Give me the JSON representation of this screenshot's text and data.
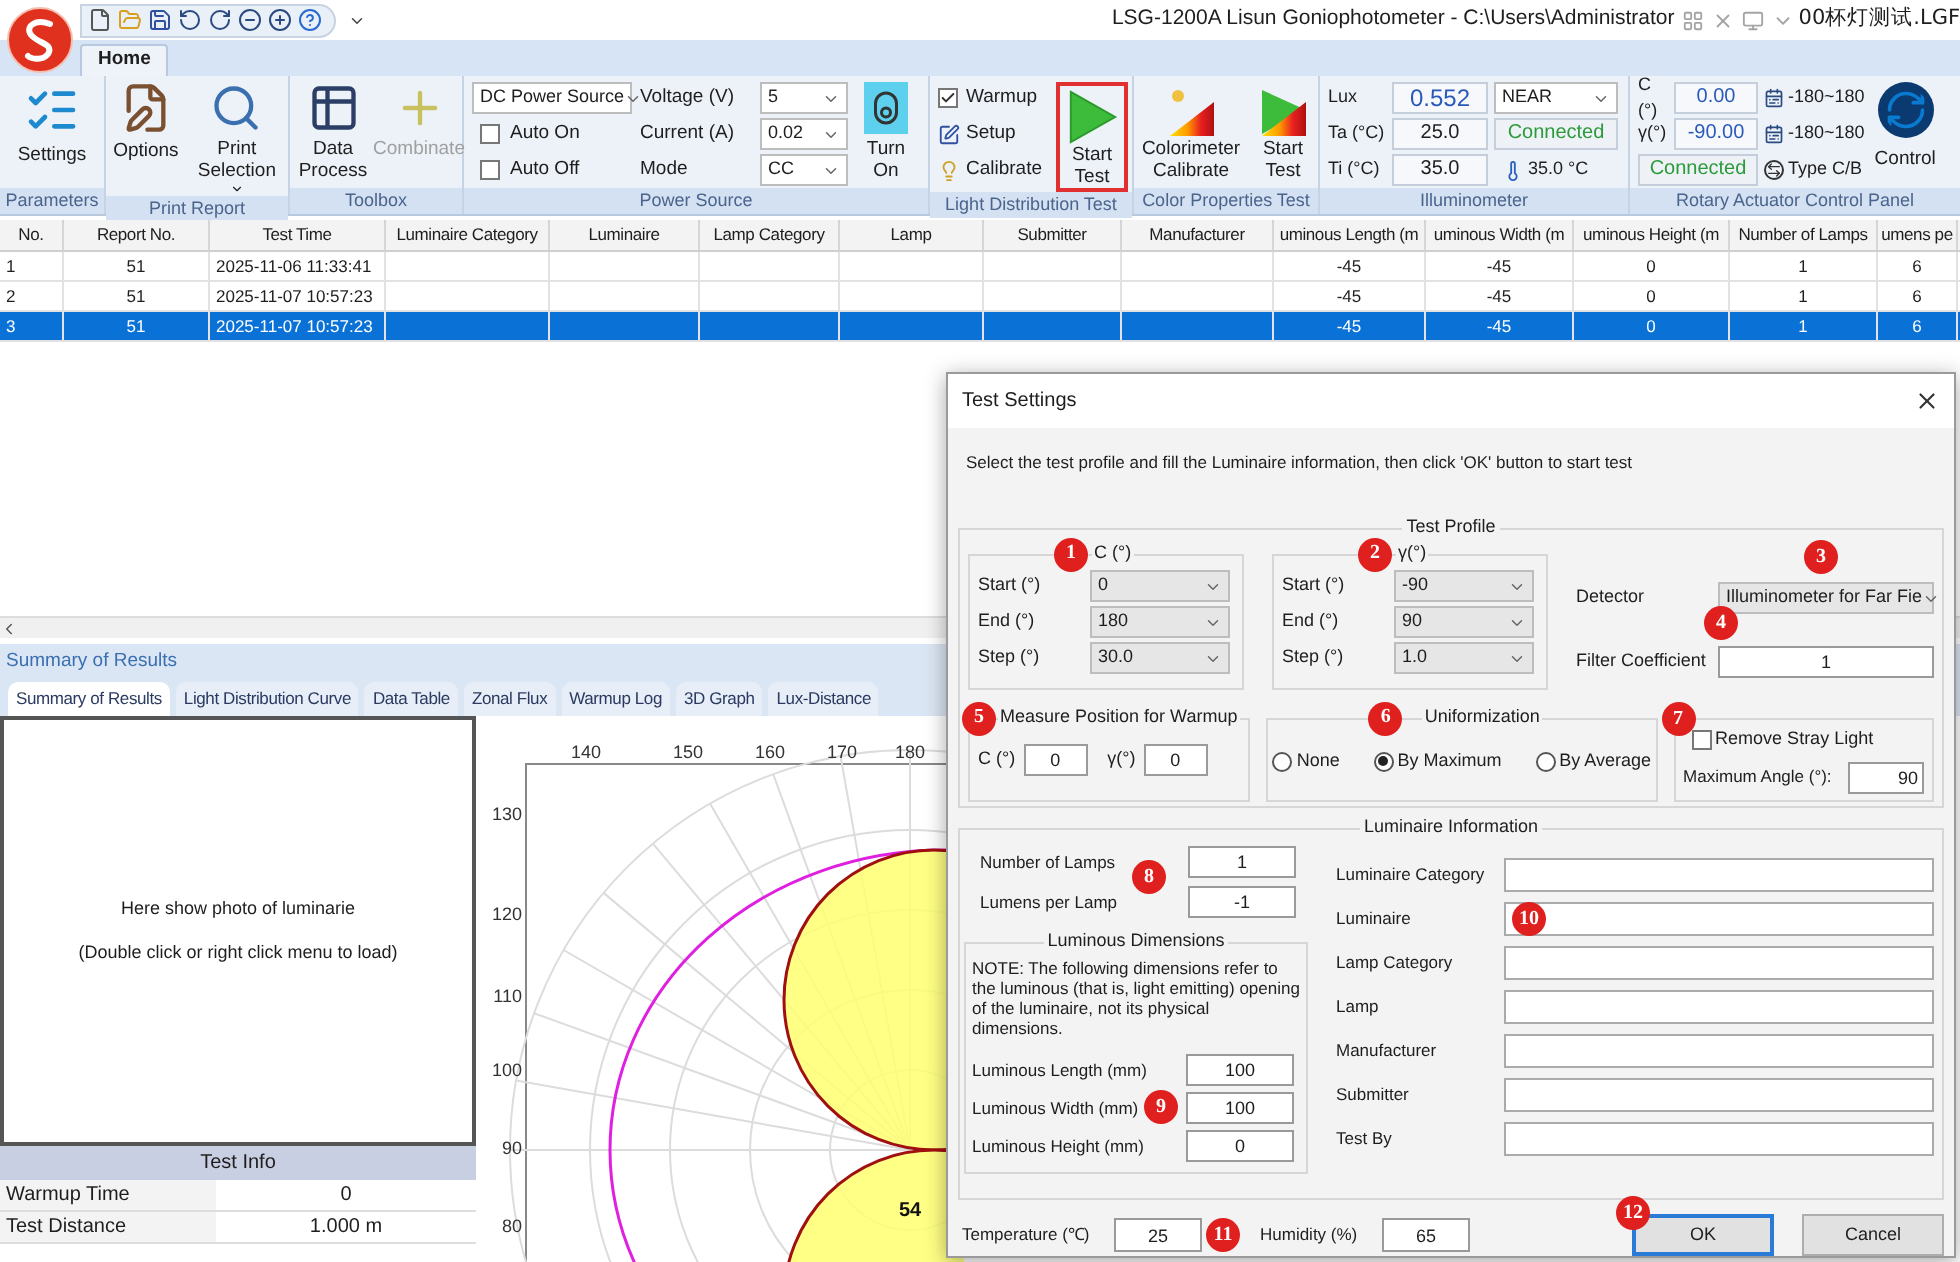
{
  "title_bar": {
    "title": "LSG-1200A Lisun Goniophotometer  - C:\\Users\\Administrator",
    "title_tail": "00杯灯测试.LGF"
  },
  "ribbon_tabs": [
    {
      "label": "Home",
      "selected": true
    }
  ],
  "ribbon": {
    "parameters_group": {
      "title": "Parameters",
      "settings": "Settings"
    },
    "print_group": {
      "title": "Print Report",
      "options": "Options",
      "print_selection": "Print Selection"
    },
    "toolbox_group": {
      "title": "Toolbox",
      "buttons": [
        {
          "label": "Data Process",
          "disabled": false
        },
        {
          "label": "Combinate",
          "disabled": true
        }
      ]
    },
    "power_group": {
      "title": "Power Source",
      "source": "DC Power Source",
      "checkboxes": [
        {
          "label": "Auto On",
          "checked": false
        },
        {
          "label": "Auto Off",
          "checked": false
        }
      ],
      "fields": [
        {
          "label": "Voltage (V)",
          "value": "5"
        },
        {
          "label": "Current (A)",
          "value": "0.02"
        },
        {
          "label": "Mode",
          "value": "CC"
        }
      ],
      "turn_on": "Turn On"
    },
    "light_group": {
      "title": "Light Distribution Test",
      "warmup": {
        "label": "Warmup",
        "checked": true
      },
      "setup": "Setup",
      "calibrate": "Calibrate",
      "start_test": {
        "label": "Start Test",
        "highlighted": true
      }
    },
    "color_group": {
      "title": "Color Properties Test",
      "calibrate": "Colorimeter Calibrate",
      "start_test": "Start Test"
    },
    "illuminometer_group": {
      "title": "Illuminometer",
      "readings": [
        {
          "label": "Lux",
          "value": "0.552"
        },
        {
          "label": "Ta (°C)",
          "value": "25.0"
        },
        {
          "label": "Ti (°C)",
          "value": "35.0"
        }
      ],
      "range": "NEAR",
      "status": "Connected",
      "temperature": "35.0 °C"
    },
    "rotary_group": {
      "title": "Rotary Actuator Control Panel",
      "readings": [
        {
          "label": "C (°)",
          "value": "0.00"
        },
        {
          "label": "γ(°)",
          "value": "-90.00"
        }
      ],
      "status": "Connected",
      "ranges": [
        "-180~180",
        "-180~180"
      ],
      "type": "Type C/B",
      "control": "Control"
    }
  },
  "report_table": {
    "columns": [
      "No.",
      "Report No.",
      "Test Time",
      "Luminaire Category",
      "Luminaire",
      "Lamp Category",
      "Lamp",
      "Submitter",
      "Manufacturer",
      "uminous Length (m",
      "uminous Width (m",
      "uminous Height (m",
      "Number of Lamps",
      "umens pe"
    ],
    "rows": [
      {
        "selected": false,
        "cells": [
          "1",
          "51",
          "2025-11-06 11:33:41",
          "",
          "",
          "",
          "",
          "",
          "",
          "-45",
          "-45",
          "0",
          "1",
          "6"
        ]
      },
      {
        "selected": false,
        "cells": [
          "2",
          "51",
          "2025-11-07 10:57:23",
          "",
          "",
          "",
          "",
          "",
          "",
          "-45",
          "-45",
          "0",
          "1",
          "6"
        ]
      },
      {
        "selected": true,
        "cells": [
          "3",
          "51",
          "2025-11-07 10:57:23",
          "",
          "",
          "",
          "",
          "",
          "",
          "-45",
          "-45",
          "0",
          "1",
          "6"
        ]
      }
    ]
  },
  "summary_panel": {
    "title": "Summary of Results",
    "tabs": [
      {
        "label": "Summary of Results",
        "selected": true
      },
      {
        "label": "Light Distribution Curve",
        "selected": false
      },
      {
        "label": "Data Table",
        "selected": false
      },
      {
        "label": "Zonal Flux",
        "selected": false
      },
      {
        "label": "Warmup Log",
        "selected": false
      },
      {
        "label": "3D Graph",
        "selected": false
      },
      {
        "label": "Lux-Distance",
        "selected": false
      }
    ],
    "photo_placeholder": [
      "Here show photo of luminarie",
      "(Double click or right click menu to load)"
    ],
    "test_info": {
      "title": "Test Info",
      "rows": [
        {
          "label": "Warmup Time",
          "value": "0"
        },
        {
          "label": "Test Distance",
          "value": "1.000 m"
        }
      ]
    },
    "polar_chart": {
      "top_labels": [
        "140",
        "150",
        "160",
        "170",
        "180"
      ],
      "left_labels": [
        "130",
        "120",
        "110",
        "100",
        "90",
        "80"
      ],
      "peak_label": "54"
    }
  },
  "dialog": {
    "title": "Test Settings",
    "instruction": "Select the test profile and fill the Luminaire information, then click 'OK' button to start test",
    "test_profile": {
      "title": "Test Profile",
      "c_group": {
        "title": "C (°)",
        "badge": "1",
        "rows": [
          {
            "label": "Start (°)",
            "value": "0"
          },
          {
            "label": "End (°)",
            "value": "180"
          },
          {
            "label": "Step (°)",
            "value": "30.0"
          }
        ]
      },
      "gamma_group": {
        "title": "γ(°)",
        "badge": "2",
        "rows": [
          {
            "label": "Start (°)",
            "value": "-90"
          },
          {
            "label": "End (°)",
            "value": "90"
          },
          {
            "label": "Step (°)",
            "value": "1.0"
          }
        ]
      },
      "detector": {
        "label": "Detector",
        "value": "Illuminometer for Far Fie",
        "badge": "3"
      },
      "filter": {
        "label": "Filter Coefficient",
        "value": "1",
        "badge": "4"
      },
      "warmup_position": {
        "title": "Measure Position for Warmup",
        "badge": "5",
        "c_label": "C (°)",
        "c_value": "0",
        "gamma_label": "γ(°)",
        "gamma_value": "0"
      },
      "uniformization": {
        "title": "Uniformization",
        "badge": "6",
        "options": [
          {
            "label": "None",
            "selected": false
          },
          {
            "label": "By Maximum",
            "selected": true
          },
          {
            "label": "By Average",
            "selected": false
          }
        ]
      },
      "stray_light": {
        "badge": "7",
        "checkbox": {
          "label": "Remove Stray Light",
          "checked": false
        },
        "angle_label": "Maximum Angle (°):",
        "angle_value": "90"
      }
    },
    "luminaire_info": {
      "title": "Luminaire Information",
      "lamps": {
        "badge": "8",
        "rows": [
          {
            "label": "Number of Lamps",
            "value": "1"
          },
          {
            "label": "Lumens per Lamp",
            "value": "-1"
          }
        ]
      },
      "dimensions": {
        "title": "Luminous Dimensions",
        "note": "NOTE: The following dimensions refer to the luminous (that is, light emitting) opening of the luminaire, not its physical dimensions.",
        "badge": "9",
        "rows": [
          {
            "label": "Luminous Length (mm)",
            "value": "100"
          },
          {
            "label": "Luminous Width (mm)",
            "value": "100"
          },
          {
            "label": "Luminous Height (mm)",
            "value": "0"
          }
        ]
      },
      "fields_badge": "10",
      "fields": [
        "Luminaire Category",
        "Luminaire",
        "Lamp Category",
        "Lamp",
        "Manufacturer",
        "Submitter",
        "Test By"
      ]
    },
    "temperature": {
      "label": "Temperature (℃)",
      "value": "25",
      "badge": "11"
    },
    "humidity": {
      "label": "Humidity (%)",
      "value": "65"
    },
    "buttons": [
      {
        "label": "OK",
        "default": true,
        "badge": "12"
      },
      {
        "label": "Cancel",
        "default": false
      }
    ]
  }
}
